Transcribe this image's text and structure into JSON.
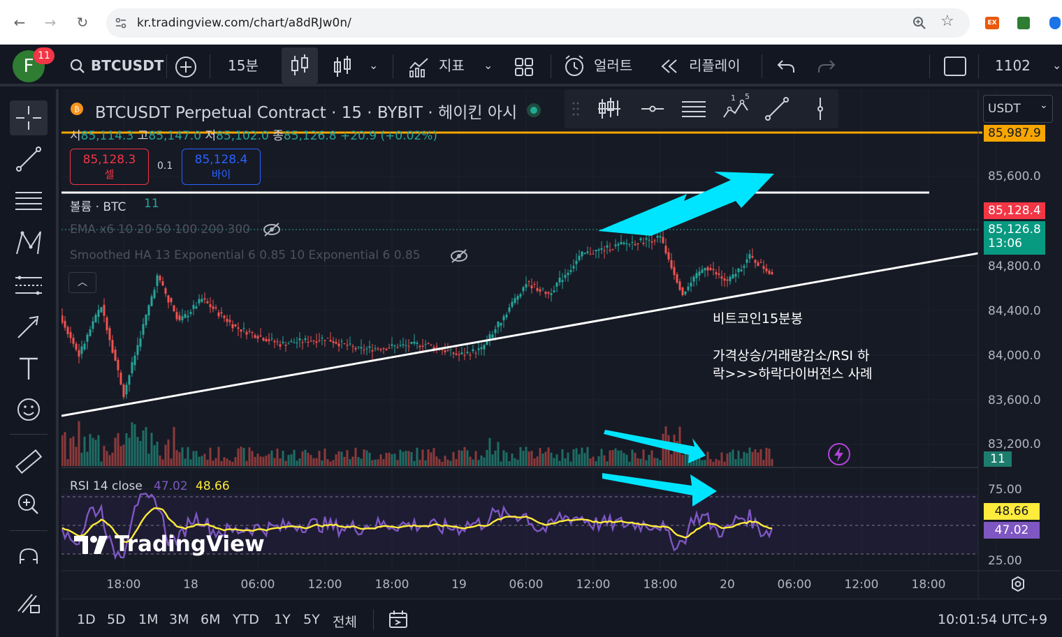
{
  "browser": {
    "url": "kr.tradingview.com/chart/a8dRJw0n/",
    "ext_label": "EX"
  },
  "toolbar": {
    "avatar_letter": "F",
    "notif_count": "11",
    "symbol": "BTCUSDT",
    "interval": "15분",
    "indicators": "지표",
    "alerts": "얼러트",
    "replay": "리플레이",
    "right_value": "1102"
  },
  "legend": {
    "title": "BTCUSDT Perpetual Contract · 15 · BYBIT · 헤이킨 아시",
    "ohlc_o_label": "시",
    "ohlc_o": "85,114.3",
    "ohlc_h_label": "고",
    "ohlc_h": "85,147.0",
    "ohlc_l_label": "저",
    "ohlc_l": "85,102.0",
    "ohlc_c_label": "종",
    "ohlc_c": "85,126.8",
    "change": "+20.9 (+0.02%)",
    "sell_price": "85,128.3",
    "sell_label": "셀",
    "spread": "0.1",
    "buy_price": "85,128.4",
    "buy_label": "바이",
    "volume_label": "볼륨 · BTC",
    "volume_value": "11",
    "ema_label": "EMA x6 10 20 50 100 200 300",
    "smoothed_label": "Smoothed HA 13 Exponential 6 0.85 10 Exponential 6 0.85",
    "rsi_label": "RSI 14 close",
    "rsi_value": "47.02",
    "rsi_ma_value": "48.66"
  },
  "currency": "USDT",
  "price_axis": {
    "ticks": [
      "85,600.0",
      "84,800.0",
      "84,400.0",
      "84,000.0",
      "83,600.0",
      "83,200.0"
    ],
    "alert_price": "85,987.9",
    "bid_price": "85,128.4",
    "last_price": "85,126.8",
    "countdown": "13:06",
    "volume_badge": "11",
    "rsi_ticks": [
      "75.00",
      "25.00"
    ],
    "rsi_ma_badge": "48.66",
    "rsi_badge": "47.02"
  },
  "time_axis": [
    "18:00",
    "18",
    "06:00",
    "12:00",
    "18:00",
    "19",
    "06:00",
    "12:00",
    "18:00",
    "20",
    "06:00",
    "12:00",
    "18:00"
  ],
  "annotation": {
    "line1": "비트코인15분봉",
    "line2": "가격상승/거래량감소/RSI 하",
    "line3": "락>>>하락다이버전스 사례"
  },
  "watermark": "TradingView",
  "bottom": {
    "ranges": [
      "1D",
      "5D",
      "1M",
      "3M",
      "6M",
      "YTD",
      "1Y",
      "5Y",
      "전체"
    ],
    "clock": "10:01:54 UTC+9"
  },
  "colors": {
    "up": "#26a69a",
    "down": "#ef5350",
    "rsi": "#7e57c2",
    "rsi_ma": "#ffeb3b",
    "alert": "#f7a600",
    "arrow": "#00e5ff"
  },
  "chart_data": [
    {
      "type": "candlestick",
      "title": "BTCUSDT Perpetual Contract · 15 · BYBIT · 헤이킨 아시",
      "x_ticks": [
        "18:00",
        "18",
        "06:00",
        "12:00",
        "18:00",
        "19",
        "06:00",
        "12:00",
        "18:00",
        "20",
        "06:00",
        "12:00",
        "18:00"
      ],
      "y_ticks": [
        83200,
        83600,
        84000,
        84400,
        84800,
        85600
      ],
      "ylim": [
        83050,
        86200
      ],
      "price_path": [
        {
          "t": "17 15:00",
          "p": 84100
        },
        {
          "t": "17 17:00",
          "p": 84500
        },
        {
          "t": "17 18:00",
          "p": 84820
        },
        {
          "t": "17 20:00",
          "p": 84400
        },
        {
          "t": "17 22:00",
          "p": 84850
        },
        {
          "t": "18 00:00",
          "p": 84050
        },
        {
          "t": "18 03:00",
          "p": 85100
        },
        {
          "t": "18 05:00",
          "p": 84700
        },
        {
          "t": "18 07:00",
          "p": 84900
        },
        {
          "t": "18 10:00",
          "p": 84650
        },
        {
          "t": "18 14:00",
          "p": 84500
        },
        {
          "t": "18 18:00",
          "p": 84550
        },
        {
          "t": "18 21:00",
          "p": 84450
        },
        {
          "t": "19 03:00",
          "p": 84500
        },
        {
          "t": "19 06:00",
          "p": 84400
        },
        {
          "t": "19 08:00",
          "p": 84450
        },
        {
          "t": "19 12:00",
          "p": 85050
        },
        {
          "t": "19 14:00",
          "p": 84950
        },
        {
          "t": "19 17:00",
          "p": 85300
        },
        {
          "t": "19 21:00",
          "p": 85400
        },
        {
          "t": "20 00:00",
          "p": 85450
        },
        {
          "t": "20 02:00",
          "p": 84950
        },
        {
          "t": "20 04:00",
          "p": 85200
        },
        {
          "t": "20 06:00",
          "p": 85050
        },
        {
          "t": "20 08:00",
          "p": 85280
        },
        {
          "t": "20 10:00",
          "p": 85126.8
        }
      ],
      "horizontal_lines": [
        85600,
        85987.9
      ]
    },
    {
      "type": "bar",
      "title": "볼륨 · BTC",
      "last_value": 11
    },
    {
      "type": "line",
      "title": "RSI 14 close",
      "y_ticks": [
        25,
        75
      ],
      "series": [
        {
          "name": "RSI 14 close",
          "last": 47.02
        },
        {
          "name": "",
          "last": 48.66
        }
      ]
    }
  ]
}
